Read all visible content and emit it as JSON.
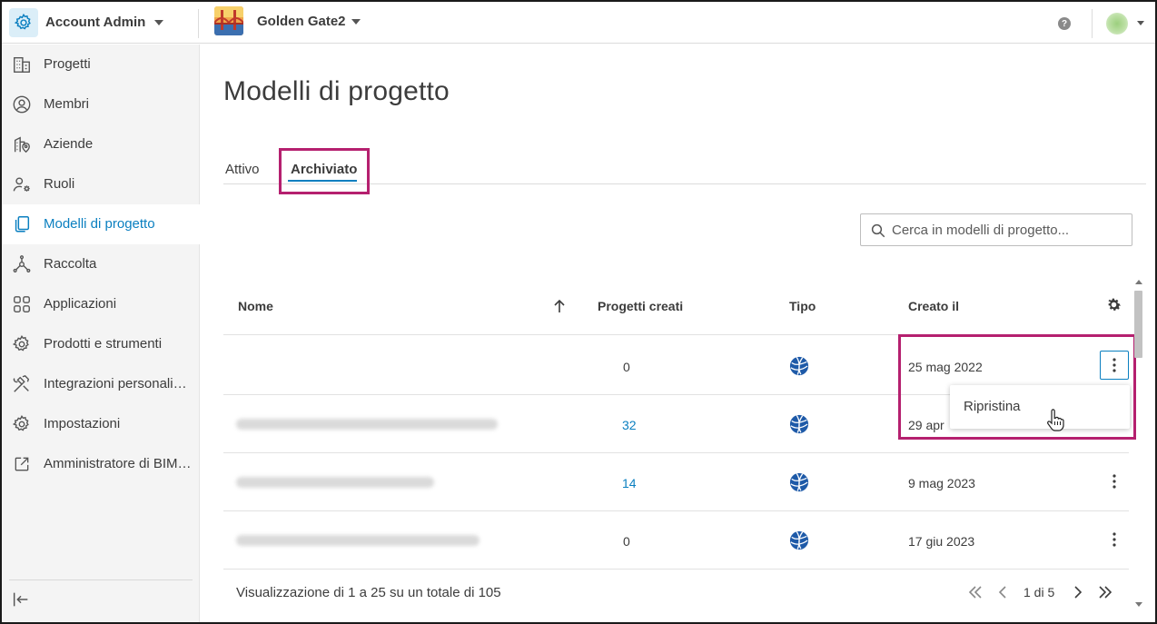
{
  "header": {
    "app_name": "Account Admin",
    "project_name": "Golden Gate2",
    "help_label": "?"
  },
  "sidebar": {
    "items": [
      {
        "label": "Progetti",
        "icon": "building-icon"
      },
      {
        "label": "Membri",
        "icon": "user-circle-icon"
      },
      {
        "label": "Aziende",
        "icon": "company-location-icon"
      },
      {
        "label": "Ruoli",
        "icon": "user-gear-icon"
      },
      {
        "label": "Modelli di progetto",
        "icon": "copy-template-icon",
        "active": true
      },
      {
        "label": "Raccolta",
        "icon": "hub-icon"
      },
      {
        "label": "Applicazioni",
        "icon": "apps-grid-icon"
      },
      {
        "label": "Prodotti e strumenti",
        "icon": "gear-tools-icon"
      },
      {
        "label": "Integrazioni personali…",
        "icon": "hammer-wrench-icon"
      },
      {
        "label": "Impostazioni",
        "icon": "settings-icon"
      },
      {
        "label": "Amministratore di BIM…",
        "icon": "external-link-icon"
      }
    ]
  },
  "main": {
    "title": "Modelli di progetto",
    "tabs": [
      {
        "label": "Attivo"
      },
      {
        "label": "Archiviato",
        "active": true
      }
    ],
    "search_placeholder": "Cerca in modelli di progetto...",
    "columns": {
      "name": "Nome",
      "projects_created": "Progetti creati",
      "type": "Tipo",
      "created": "Creato il"
    },
    "rows": [
      {
        "projects": "0",
        "created": "25 mag 2022",
        "link": false
      },
      {
        "projects": "32",
        "created": "29 apr",
        "link": true
      },
      {
        "projects": "14",
        "created": "9 mag 2023",
        "link": true
      },
      {
        "projects": "0",
        "created": "17 giu 2023",
        "link": false
      }
    ],
    "row_menu": {
      "restore_label": "Ripristina"
    },
    "footer": {
      "summary": "Visualizzazione di 1 a 25 su un totale di 105",
      "page_indicator": "1 di 5"
    }
  },
  "colors": {
    "accent": "#0a7fc0",
    "highlight": "#b5206f"
  }
}
